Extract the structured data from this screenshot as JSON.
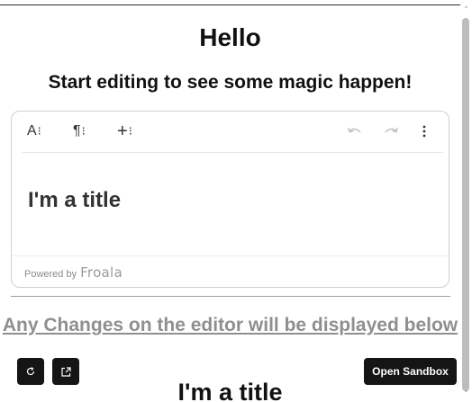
{
  "page": {
    "heading": "Hello",
    "subheading": "Start editing to see some magic happen!"
  },
  "editor": {
    "toolbar": {
      "text_size_icon": "A",
      "paragraph_icon": "¶",
      "insert_icon": "+",
      "undo_icon": "undo-icon",
      "redo_icon": "redo-icon",
      "more_icon": "more-vertical-icon"
    },
    "content_title": "I'm a title",
    "powered_by_label": "Powered by",
    "brand": "Froala"
  },
  "preview": {
    "heading": "Any Changes on the editor will be displayed below",
    "title": "I'm a title"
  },
  "controls": {
    "refresh_icon": "refresh-icon",
    "open_new_window_icon": "external-link-icon",
    "open_sandbox_label": "Open Sandbox"
  },
  "colors": {
    "button_bg": "#151515",
    "muted_heading": "#8f8f8f"
  }
}
